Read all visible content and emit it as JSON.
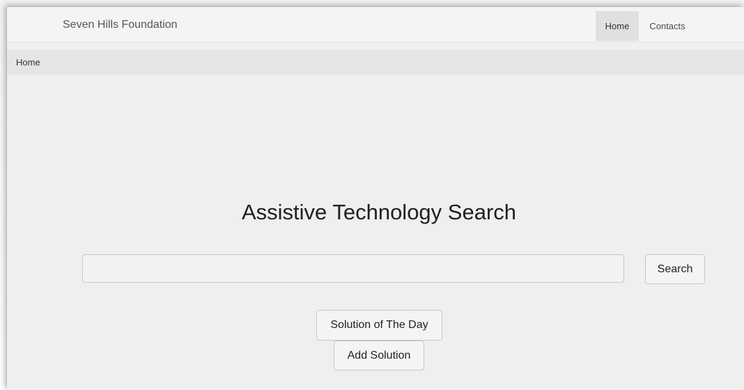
{
  "navbar": {
    "brand": "Seven Hills Foundation",
    "items": [
      {
        "label": "Home",
        "active": true
      },
      {
        "label": "Contacts",
        "active": false
      }
    ]
  },
  "breadcrumb": {
    "items": [
      {
        "label": "Home"
      }
    ]
  },
  "main": {
    "title": "Assistive Technology Search",
    "search": {
      "value": "",
      "placeholder": "",
      "button_label": "Search"
    },
    "actions": {
      "solution_of_the_day_label": "Solution of The Day",
      "add_solution_label": "Add Solution"
    }
  },
  "colors": {
    "page_background": "#efefef",
    "navbar_background": "#f4f4f4",
    "active_nav_background": "#e0e0e0",
    "breadcrumb_background": "#e5e5e5",
    "button_border": "#c7c7c7"
  }
}
